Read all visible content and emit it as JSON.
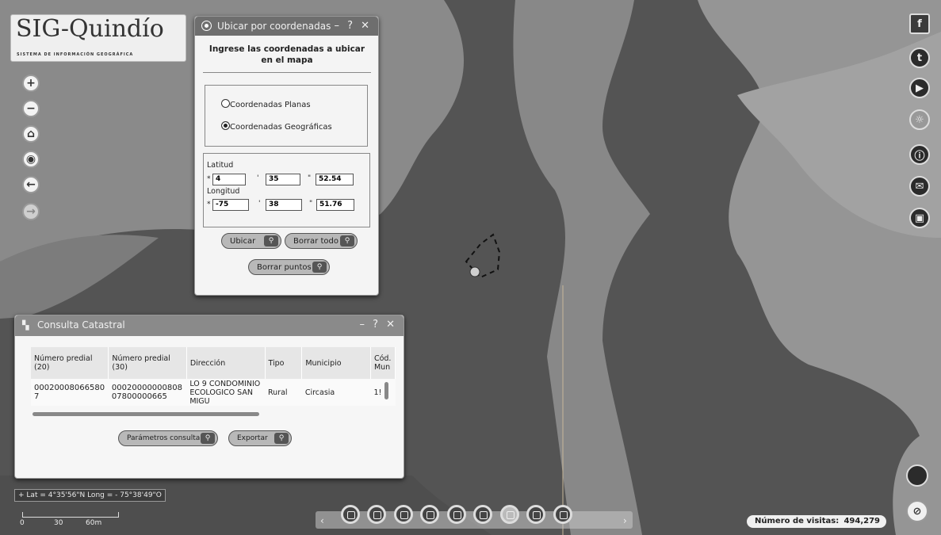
{
  "logo": {
    "title": "SIG-Quindío",
    "subtitle": "SISTEMA DE INFORMACIÓN GEOGRÁFICA"
  },
  "map_controls": [
    {
      "name": "zoom-in-button",
      "glyph": "+"
    },
    {
      "name": "zoom-out-button",
      "glyph": "−"
    },
    {
      "name": "home-button",
      "glyph": "⌂"
    },
    {
      "name": "locate-button",
      "glyph": "◉"
    },
    {
      "name": "back-button",
      "glyph": "←"
    },
    {
      "name": "forward-button",
      "glyph": "→"
    }
  ],
  "coord_window": {
    "title": "Ubicar por coordenadas",
    "controls": "– ? ✕",
    "heading": "Ingrese las coordenadas a ubicar en el mapa",
    "option_planas": "Coordenadas Planas",
    "option_geograficas": "Coordenadas Geográficas",
    "selected": "geograficas",
    "lat_label": "Latitud",
    "lat_deg": "4",
    "lat_min": "35",
    "lat_sec": "52.54",
    "lon_label": "Longitud",
    "lon_deg": "-75",
    "lon_min": "38",
    "lon_sec": "51.76",
    "btn_ubicar": "Ubicar",
    "btn_borrar_todo": "Borrar todo",
    "btn_borrar_puntos": "Borrar puntos"
  },
  "catastral_window": {
    "title": "Consulta Catastral",
    "controls": "– ? ✕",
    "columns": [
      "Número predial (20)",
      "Número predial (30)",
      "Dirección",
      "Tipo",
      "Municipio",
      "Cód. Mun"
    ],
    "rows": [
      [
        "00020008066580 7",
        "00020000000808 07800000665",
        "LO 9 CONDOMINIO ECOLOGICO SAN MIGU",
        "Rural",
        "Circasia",
        "1!"
      ]
    ],
    "btn_parametros": "Parámetros consulta",
    "btn_exportar": "Exportar"
  },
  "coords_readout": "Lat = 4°35'56\"N Long = - 75°38'49\"O",
  "scale": {
    "labels": [
      "0",
      "30",
      "60m"
    ]
  },
  "visits": {
    "label": "Número de visitas:",
    "value": "494,279"
  },
  "social": [
    "f",
    "t",
    "▶",
    "☼",
    "ⓘ",
    "✉",
    "▣"
  ],
  "toolbar_count": 9,
  "colors": {
    "map_dark": "#4a4a4a",
    "map_mid": "#7e7e7e",
    "map_light": "#9c9c9c",
    "window_bg": "#f4f4f4",
    "titlebar": "#6e6e6e"
  }
}
